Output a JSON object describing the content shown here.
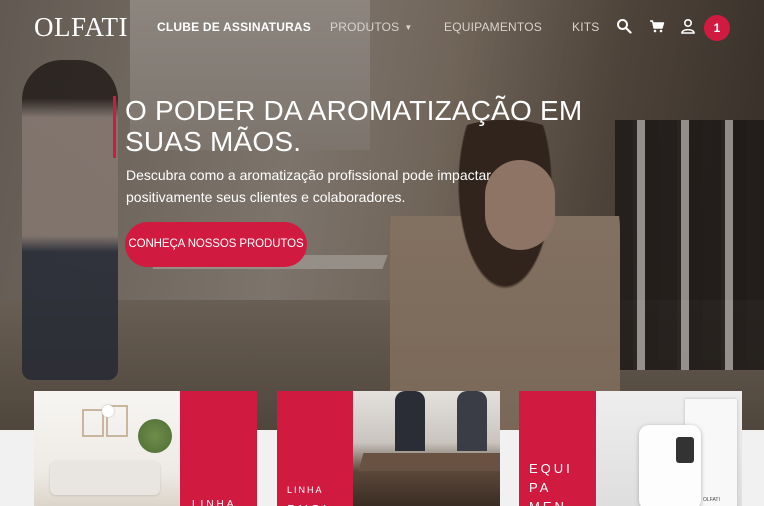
{
  "brand": {
    "logo": "OLFATI",
    "accent_color": "#d11a40"
  },
  "nav": {
    "items": [
      {
        "label": "CLUBE DE ASSINATURAS"
      },
      {
        "label": "PRODUTOS"
      },
      {
        "label": "EQUIPAMENTOS"
      },
      {
        "label": "KITS"
      }
    ],
    "icons": [
      "search-icon",
      "cart-icon",
      "user-icon"
    ],
    "cart_count": "1"
  },
  "hero": {
    "title": "O PODER DA AROMATIZAÇÃO EM SUAS MÃOS.",
    "subtitle": "Descubra como a aromatização profissional pode impactar positivamente seus clientes e colaboradores.",
    "cta_label": "CONHEÇA NOSSOS PRODUTOS"
  },
  "cards": [
    {
      "label": "LINHA"
    },
    {
      "label": "LINHA BUSI"
    },
    {
      "label": "EQUI PA MEN"
    }
  ],
  "device_label": "OLFATI"
}
